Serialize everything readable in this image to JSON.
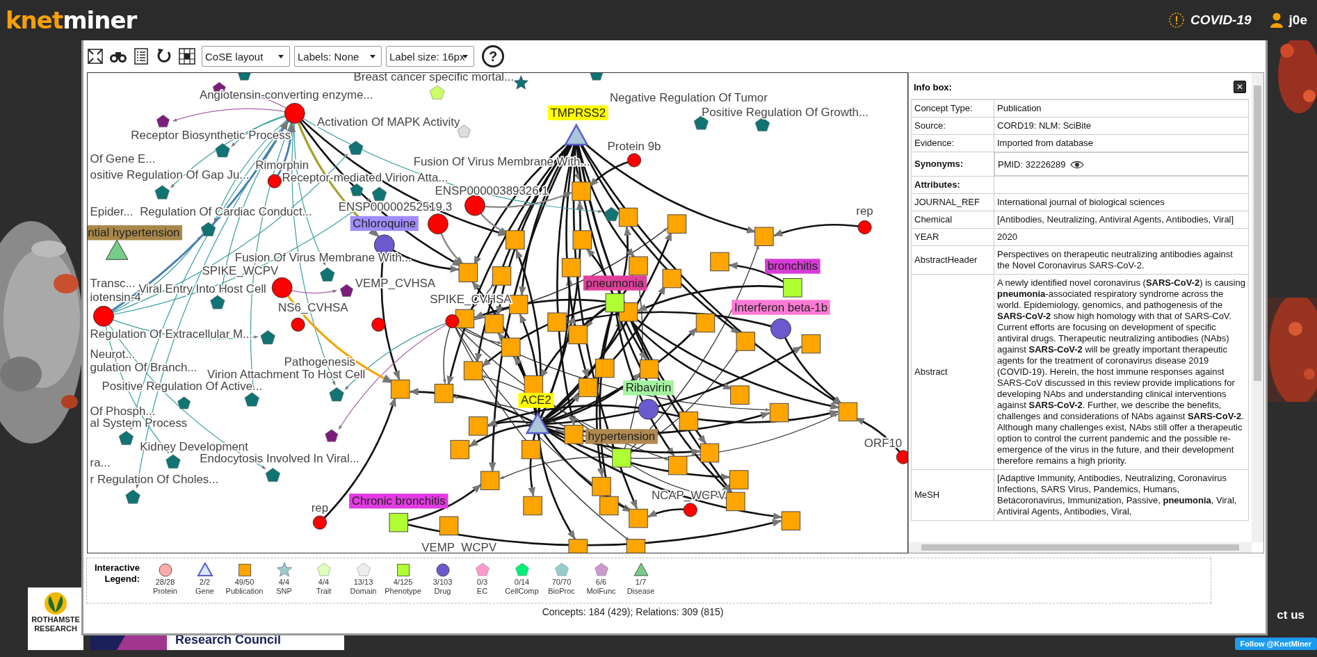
{
  "header": {
    "logo": {
      "accent": "knet",
      "rest": "miner"
    },
    "dataset": "COVID-19",
    "user": "j0e"
  },
  "toolbar": {
    "tools": [
      {
        "kind": "fit"
      },
      {
        "kind": "find"
      },
      {
        "kind": "list"
      },
      {
        "kind": "reset"
      },
      {
        "kind": "grid"
      }
    ],
    "selects": [
      {
        "value": "CoSE layout"
      },
      {
        "value": "Labels: None"
      },
      {
        "value": "Label size: 16px"
      }
    ],
    "help": "?"
  },
  "graph": {
    "nodes": [
      {
        "label": "Breast cancer specific mortal...",
        "kind": "trait"
      },
      {
        "label": "Angiotensin-converting enzyme...",
        "kind": "protein"
      },
      {
        "label": "Receptor Biosynthetic Process",
        "kind": "bioproc"
      },
      {
        "label": "Activation Of MAPK Activity",
        "kind": "bioproc"
      },
      {
        "label": "TMPRSS2",
        "kind": "gene",
        "color": "#ffff00"
      },
      {
        "label": "Negative Regulation Of Tumor",
        "kind": "bioproc"
      },
      {
        "label": "Positive Regulation Of Growth...",
        "kind": "bioproc"
      },
      {
        "label": "Protein 9b",
        "kind": "protein"
      },
      {
        "label": "Of Gene E..."
      },
      {
        "label": "Rimorphin",
        "kind": "protein"
      },
      {
        "label": "ositive Regulation Of Gap Ju...",
        "kind": "bioproc"
      },
      {
        "label": "Receptor-mediated Virion Atta...",
        "kind": "bioproc"
      },
      {
        "label": "Fusion Of Virus Membrane With...",
        "kind": "bioproc"
      },
      {
        "label": "ENSP00000389326.1",
        "kind": "protein"
      },
      {
        "label": "ENSP00000252519.3",
        "kind": "protein"
      },
      {
        "label": "Epider..."
      },
      {
        "label": "Regulation Of Cardiac Conduct...",
        "kind": "bioproc"
      },
      {
        "label": "ntial hypertension",
        "kind": "disease",
        "color": "#a8884a"
      },
      {
        "label": "Chloroquine",
        "kind": "drug",
        "color": "#a08cff"
      },
      {
        "label": "rep",
        "kind": "protein"
      },
      {
        "label": "Fusion Of Virus Membrane With...",
        "kind": "bioproc"
      },
      {
        "label": "SPIKE_WCPV",
        "kind": "protein"
      },
      {
        "label": "bronchitis",
        "kind": "phenotype",
        "color": "#d63cd6"
      },
      {
        "label": "Transc..."
      },
      {
        "label": "pneumonia",
        "kind": "phenotype",
        "color": "#e0409a"
      },
      {
        "label": "iotensin-4",
        "kind": "protein"
      },
      {
        "label": "Viral Entry Into Host Cell",
        "kind": "bioproc"
      },
      {
        "label": "NS6_CVHSA",
        "kind": "protein"
      },
      {
        "label": "VEMP_CVHSA",
        "kind": "protein"
      },
      {
        "label": "SPIKE_CVHSA",
        "kind": "protein"
      },
      {
        "label": "Interferon beta-1b",
        "kind": "drug",
        "color": "#ff7ad6"
      },
      {
        "label": "Regulation Of Extracellular M...",
        "kind": "bioproc"
      },
      {
        "label": "Neurot..."
      },
      {
        "label": "gulation Of Branch..."
      },
      {
        "label": "Positive Regulation Of Active...",
        "kind": "bioproc"
      },
      {
        "label": "Pathogenesis"
      },
      {
        "label": "Virion Attachment To Host Cell",
        "kind": "bioproc"
      },
      {
        "label": "ACE2",
        "kind": "gene",
        "color": "#ffff00"
      },
      {
        "label": "Ribavirin",
        "kind": "drug",
        "color": "#a4f3a0"
      },
      {
        "label": "Of Phosph..."
      },
      {
        "label": "al System Process",
        "kind": "bioproc"
      },
      {
        "label": "Kidney Development",
        "kind": "bioproc"
      },
      {
        "label": "hypertension",
        "kind": "phenotype",
        "color": "#b08a52"
      },
      {
        "label": "ORF10",
        "kind": "protein"
      },
      {
        "label": "ra..."
      },
      {
        "label": "Endocytosis Involved In Viral...",
        "kind": "bioproc"
      },
      {
        "label": "r Regulation Of Choles...",
        "kind": "bioproc"
      },
      {
        "label": "NCAP_WCPV",
        "kind": "protein"
      },
      {
        "label": "rep",
        "kind": "protein"
      },
      {
        "label": "Chronic bronchitis",
        "kind": "phenotype",
        "color": "#e23be2"
      },
      {
        "label": "VEMP_WCPV"
      }
    ]
  },
  "info_box": {
    "title": "Info box:",
    "close": "✕",
    "rows": [
      {
        "kind": "field",
        "label": "Concept Type:",
        "value": "Publication"
      },
      {
        "kind": "field",
        "label": "Source:",
        "value": "CORD19: NLM: SciBite"
      },
      {
        "kind": "field",
        "label": "Evidence:",
        "value": "Imported from database"
      },
      {
        "kind": "synonym",
        "label": "Synonyms:",
        "value": "PMID: 32226289"
      },
      {
        "kind": "heading",
        "label": "Attributes:"
      },
      {
        "kind": "field",
        "label": "JOURNAL_REF",
        "value": "International journal of biological sciences"
      },
      {
        "kind": "field",
        "label": "Chemical",
        "value": "[Antibodies, Neutralizing, Antiviral Agents, Antibodies, Viral]"
      },
      {
        "kind": "field",
        "label": "YEAR",
        "value": "2020"
      },
      {
        "kind": "field",
        "label": "AbstractHeader",
        "value": "Perspectives on therapeutic neutralizing antibodies against the Novel Coronavirus SARS-CoV-2."
      },
      {
        "kind": "field",
        "label": "Abstract",
        "value": "A newly identified novel coronavirus (**SARS-CoV-2**) is causing **pneumonia**-associated respiratory syndrome across the world. Epidemiology, genomics, and pathogenesis of the **SARS-CoV-2** show high homology with that of SARS-CoV. Current efforts are focusing on development of specific antiviral drugs. Therapeutic neutralizing antibodies (NAbs) against **SARS-CoV-2** will be greatly important therapeutic agents for the treatment of coronavirus disease 2019 (COVID-19). Herein, the host immune responses against SARS-CoV discussed in this review provide implications for developing NAbs and understanding clinical interventions against **SARS-CoV-2**. Further, we describe the benefits, challenges and considerations of NAbs against **SARS-CoV-2**. Although many challenges exist, NAbs still offer a therapeutic option to control the current pandemic and the possible re-emergence of the virus in the future, and their development therefore remains a high priority."
      },
      {
        "kind": "field",
        "label": "MeSH",
        "value": "[Adaptive Immunity, Antibodies, Neutralizing, Coronavirus Infections, SARS Virus, Pandemics, Humans, Betacoronavirus, Immunization, Passive, **pneumonia**, Viral, Antiviral Agents, Antibodies, Viral,"
      }
    ]
  },
  "legend": {
    "title": "Interactive Legend:",
    "items": [
      {
        "kind": "protein",
        "count": "28/28",
        "label": "Protein"
      },
      {
        "kind": "gene",
        "count": "2/2",
        "label": "Gene"
      },
      {
        "kind": "publication",
        "count": "49/50",
        "label": "Publication"
      },
      {
        "kind": "snp",
        "count": "4/4",
        "label": "SNP"
      },
      {
        "kind": "trait",
        "count": "4/4",
        "label": "Trait"
      },
      {
        "kind": "domain",
        "count": "13/13",
        "label": "Domain"
      },
      {
        "kind": "phenotype",
        "count": "4/125",
        "label": "Phenotype"
      },
      {
        "kind": "drug",
        "count": "3/103",
        "label": "Drug"
      },
      {
        "kind": "ec",
        "count": "0/3",
        "label": "EC"
      },
      {
        "kind": "cellcomp",
        "count": "0/14",
        "label": "CellComp"
      },
      {
        "kind": "bioproc",
        "count": "70/70",
        "label": "BioProc"
      },
      {
        "kind": "molfunc",
        "count": "6/6",
        "label": "MolFunc"
      },
      {
        "kind": "disease",
        "count": "1/7",
        "label": "Disease"
      }
    ]
  },
  "status": "Concepts: 184 (429); Relations: 309 (815)",
  "footer": {
    "logo_lines": [
      "ROTHAMSTE",
      "RESEARCH"
    ],
    "council": "Research Council",
    "contact": "ct us",
    "follow": "Follow @KnetMiner"
  }
}
